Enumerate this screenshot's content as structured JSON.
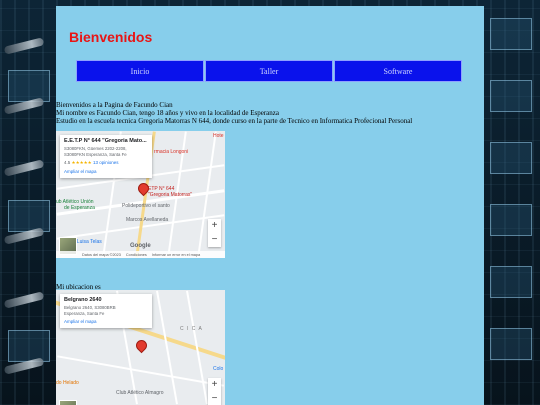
{
  "header": {
    "title": "Bienvenidos"
  },
  "nav": {
    "items": [
      {
        "label": "Inicio"
      },
      {
        "label": "Taller"
      },
      {
        "label": "Software"
      }
    ]
  },
  "intro": {
    "line1": "Bienvenidos a la Pagina de Facundo Cian",
    "line2": "Mi nombre es Facundo Cian, tengo 18 años y vivo en la localidad de Esperanza",
    "line3": "Estudio en la escuela tecnica Gregoria Matorras N 644, donde curso en la parte de Tecnico en Informatica Profecional Personal"
  },
  "map1": {
    "card": {
      "name": "E.E.T.P N° 644 \"Gregoria Mato...",
      "address1": "S3080FKN, Güemes 2202-2208,",
      "address2": "S3080FKN Esperanza, Santa Fe",
      "rating": "4.5",
      "stars": "★★★★★",
      "reviews": "13 opiniones",
      "link": "Ampliar el mapa"
    },
    "labels": {
      "pharmacy": "rmacia Longoni",
      "school": "ETP N° 644",
      "school2": "\"Gregoria Matorras\"",
      "club": "ub Atlético Unión",
      "club2": "de Esperanza",
      "center": "Polideportivo el santo",
      "street": "Marcos Avellaneda",
      "store": "Muy Luisa Telas",
      "hotel": "Hote"
    },
    "zoom_in": "+",
    "zoom_out": "−",
    "google": "Google",
    "footer": {
      "shortcuts": "Combinaciones de teclas",
      "data": "Datos del mapa ©2023",
      "terms": "Condiciones",
      "report": "Informar un error en el mapa"
    }
  },
  "location": {
    "label": "Mi ubicacion es"
  },
  "map2": {
    "card": {
      "name": "Belgrano 2640",
      "address1": "Belgrano 2640, S3080BRB",
      "address2": "Esperanza, Santa Fe",
      "link": "Ampliar el mapa"
    },
    "labels": {
      "letters": "C I C A",
      "icecream": "do Helado",
      "club": "Club Atlético Almagro",
      "colo": "Colo"
    },
    "zoom_in": "+",
    "zoom_out": "−"
  },
  "colors": {
    "page_bg": "#87ceeb",
    "title": "#e81515",
    "nav_bg": "#0a12ec"
  }
}
